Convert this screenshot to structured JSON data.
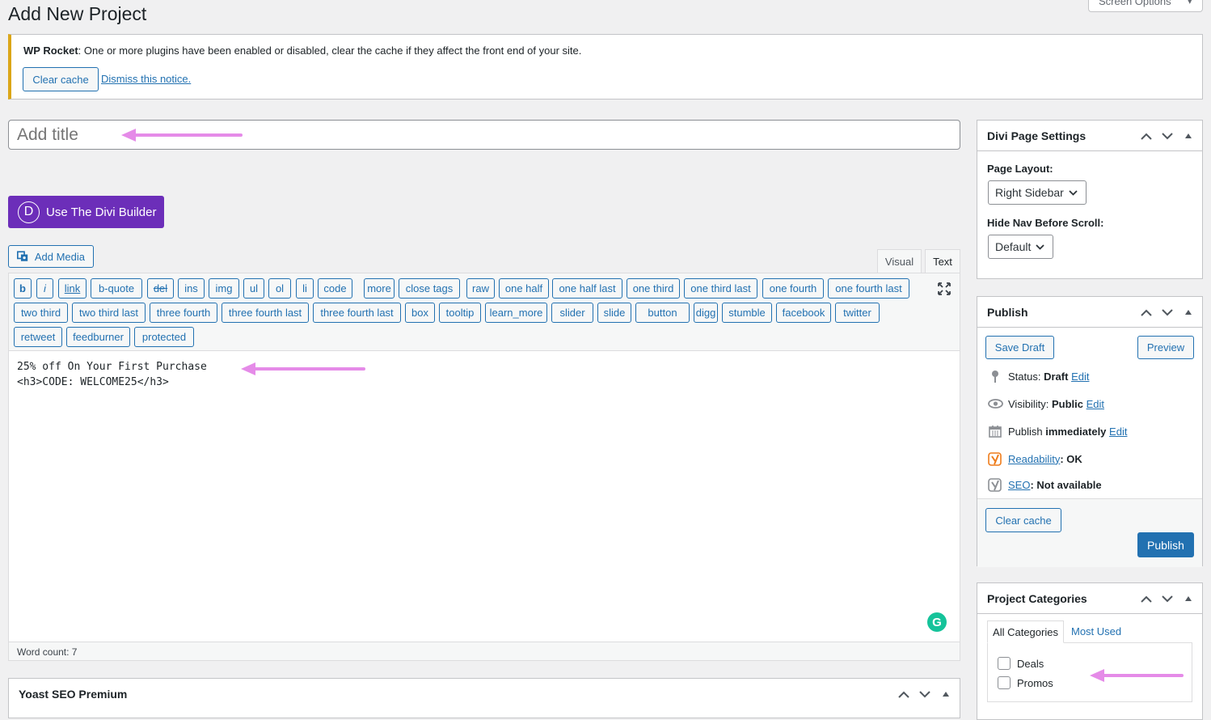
{
  "page": {
    "title": "Add New Project",
    "screen_options": "Screen Options"
  },
  "notice": {
    "brand": "WP Rocket",
    "message": ": One or more plugins have been enabled or disabled, clear the cache if they affect the front end of your site.",
    "clear_cache": "Clear cache",
    "dismiss": "Dismiss this notice."
  },
  "title_input": {
    "placeholder": "Add title"
  },
  "divi": {
    "logo_letter": "D",
    "label": "Use The Divi Builder"
  },
  "editor": {
    "add_media": "Add Media",
    "tab_visual": "Visual",
    "tab_text": "Text",
    "quicktags_row1": [
      "b",
      "i",
      "link",
      "b-quote",
      "del",
      "ins",
      "img",
      "ul",
      "ol",
      "li",
      "code",
      "more",
      "close tags",
      "raw",
      "one half",
      "one half last",
      "one third",
      "one third last",
      "one fourth",
      "one fourth last"
    ],
    "quicktags_row2": [
      "two third",
      "two third last",
      "three fourth",
      "three fourth last",
      "three fourth last",
      "box",
      "tooltip",
      "learn_more",
      "slider",
      "slide",
      "button",
      "digg",
      "stumble",
      "facebook",
      "twitter"
    ],
    "quicktags_row3": [
      "retweet",
      "feedburner",
      "protected"
    ],
    "content_line1": "25% off On Your First Purchase",
    "content_line2": "<h3>CODE: WELCOME25</h3>",
    "word_count": "Word count: 7",
    "grammarly_letter": "G"
  },
  "yoast": {
    "title": "Yoast SEO Premium"
  },
  "divi_settings": {
    "title": "Divi Page Settings",
    "layout_label": "Page Layout:",
    "layout_value": "Right Sidebar",
    "hidenav_label": "Hide Nav Before Scroll:",
    "hidenav_value": "Default"
  },
  "publish": {
    "title": "Publish",
    "save_draft": "Save Draft",
    "preview": "Preview",
    "status_label": "Status: ",
    "status_value": "Draft",
    "visibility_label": "Visibility: ",
    "visibility_value": "Public",
    "publish_label": "Publish ",
    "publish_value": "immediately",
    "edit": "Edit",
    "readability_link": "Readability",
    "readability_value": ": OK",
    "seo_link": "SEO",
    "seo_value": ": Not available",
    "clear_cache": "Clear cache",
    "publish_button": "Publish"
  },
  "categories": {
    "title": "Project Categories",
    "tab_all": "All Categories",
    "tab_most_used": "Most Used",
    "items": [
      "Deals",
      "Promos"
    ]
  },
  "colors": {
    "accent": "#2271b1",
    "divi": "#6c2eb9",
    "notice_border": "#dba617",
    "arrow": "#e58be8"
  }
}
